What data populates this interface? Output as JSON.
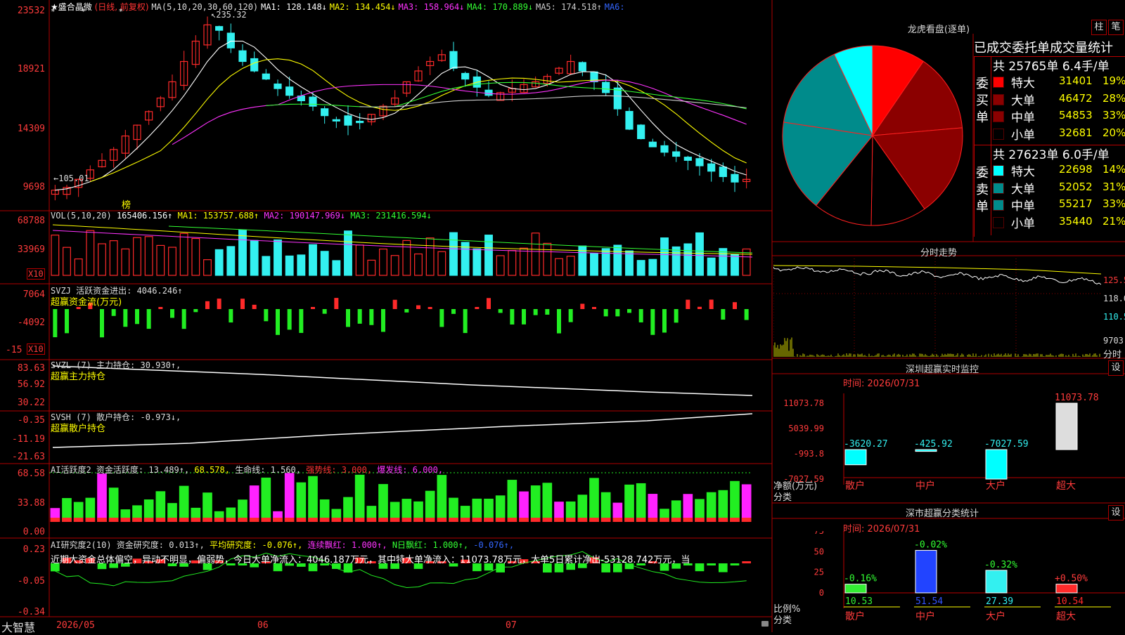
{
  "colors": {
    "up": "#ff2a2a",
    "down": "#33f0f0",
    "grid": "#8b0000",
    "ma1": "#ffffff",
    "ma2": "#ffff00",
    "ma3": "#ff33ff",
    "ma4": "#33ff33",
    "ma5": "#cccccc",
    "green": "#22ee22",
    "magenta": "#ff22ff"
  },
  "main": {
    "stock": "★盛合晶微",
    "mode": "(日线, 前复权)",
    "ma_label": "MA(5,10,20,30,60,120)",
    "ma1": "MA1: 128.148↓",
    "ma2": "MA2: 134.454↓",
    "ma3": "MA3: 158.964↓",
    "ma4": "MA4: 170.889↓",
    "ma5": "MA5: 174.518↑",
    "ma6": "MA6:",
    "y_ticks": [
      "23532",
      "18921",
      "14309",
      "9698"
    ],
    "high_label": "235.32",
    "low_label": "105.01",
    "bang": "榜",
    "stars": [
      "*",
      "*",
      "*"
    ]
  },
  "vol": {
    "label": "VOL(5,10,20)",
    "val": "165406.156↑",
    "ma1": "MA1: 153757.688↑",
    "ma2": "MA2: 190147.969↓",
    "ma3": "MA3: 231416.594↓",
    "y_ticks": [
      "68788",
      "33969"
    ],
    "x10": "X10"
  },
  "svzj": {
    "label": "SVZJ  活跃资金进出: 4046.246↑",
    "sub": "超赢资金流(万元)",
    "y_ticks": [
      "7064",
      "-4092",
      "-15"
    ],
    "x10": "X10"
  },
  "svzl": {
    "label": "SVZL (7) 主力持仓: 30.930↑,",
    "sub": "超赢主力持仓",
    "y_ticks": [
      "83.63",
      "56.92",
      "30.22"
    ]
  },
  "svsh": {
    "label": "SVSH (7) 散户持仓: -0.973↓,",
    "sub": "超赢散户持仓",
    "y_ticks": [
      "-0.35",
      "-11.19",
      "-21.63"
    ]
  },
  "ai2": {
    "label": "AI活跃度2 资金活跃度: 13.489↑,",
    "v2": "68.578,",
    "v3": "生命线: 1.560,",
    "v4": "强势线: 3.000,",
    "v5": "爆发线: 6.000,",
    "y_ticks": [
      "68.58",
      "33.88",
      "0.00"
    ]
  },
  "ai_research": {
    "label": "AI研究度2(10) 资金研究度: 0.013↑,",
    "v2": "平均研究度: -0.076↑,",
    "v3": "连续飘红: 1.000↑,",
    "v4": "N日飘红: 1.000↑,",
    "v5": "-0.076↑,",
    "text": "近期大资金总体偏空，异动不明显，偏弱势，今日大单净流入：4046.187万元，其中特大单净流入：11073.78万元，大单5日累计净出-53128.742万元，当",
    "y_ticks": [
      "0.23",
      "-0.05",
      "-0.34"
    ]
  },
  "x_axis": {
    "brand": "大智慧",
    "months": [
      "2026/05",
      "06",
      "07"
    ]
  },
  "longhu": {
    "title": "龙虎看盘(逐单)",
    "btn1": "柱",
    "btn2": "笔",
    "header": "已成交委托单成交量统计",
    "buy": {
      "side": "委买单",
      "total": "共 25765单 6.4手/单",
      "rows": [
        {
          "name": "特大",
          "vol": "31401",
          "pct": "19%",
          "color": "#ff0000"
        },
        {
          "name": "大单",
          "vol": "46472",
          "pct": "28%",
          "color": "#8b0000"
        },
        {
          "name": "中单",
          "vol": "54853",
          "pct": "33%",
          "color": "#8b0000"
        },
        {
          "name": "小单",
          "vol": "32681",
          "pct": "20%",
          "color": "#000000"
        }
      ]
    },
    "sell": {
      "side": "委卖单",
      "total": "共 27623单 6.0手/单",
      "rows": [
        {
          "name": "特大",
          "vol": "22698",
          "pct": "14%",
          "color": "#00ffff"
        },
        {
          "name": "大单",
          "vol": "52052",
          "pct": "31%",
          "color": "#008b8b"
        },
        {
          "name": "中单",
          "vol": "55217",
          "pct": "33%",
          "color": "#008b8b"
        },
        {
          "name": "小单",
          "vol": "35440",
          "pct": "21%",
          "color": "#000000"
        }
      ]
    }
  },
  "fenshi": {
    "title": "分时走势",
    "y_ticks": [
      "125.5",
      "118.0",
      "110.5"
    ],
    "vol_tick": "9703",
    "label": "分时"
  },
  "monitor": {
    "title": "深圳超赢实时监控",
    "btn": "设",
    "time": "时间: 2026/07/31",
    "y_ticks": [
      "11073.78",
      "5039.99",
      "-993.8",
      "-7027.59"
    ],
    "cats": [
      "散户",
      "中户",
      "大户",
      "超大"
    ],
    "values": [
      "-3620.27",
      "-425.92",
      "-7027.59",
      "11073.78"
    ],
    "ylabel1": "净额(万元)",
    "ylabel2": "分类"
  },
  "classify": {
    "title": "深市超赢分类统计",
    "btn": "设",
    "time": "时间: 2026/07/31",
    "y_ticks": [
      "75",
      "50",
      "25",
      "0"
    ],
    "cats": [
      "散户",
      "中户",
      "大户",
      "超大"
    ],
    "changes": [
      "-0.16%",
      "-0.02%",
      "-0.32%",
      "+0.50%"
    ],
    "values": [
      "10.53",
      "51.54",
      "27.39",
      "10.54"
    ],
    "ylabel1": "比例%",
    "ylabel2": "分类"
  }
}
